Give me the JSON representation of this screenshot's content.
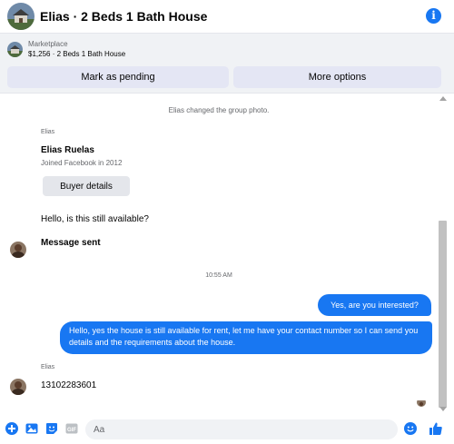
{
  "header": {
    "title": "Elias · 2 Beds 1 Bath House",
    "avatar_icon": "house-photo-icon",
    "info_icon": "info-icon"
  },
  "marketplace": {
    "label": "Marketplace",
    "listing": "$1,256 · 2 Beds 1 Bath House",
    "pending_button": "Mark as pending",
    "more_button": "More options"
  },
  "chat": {
    "system_notice": "Elias changed the group photo.",
    "profile": {
      "sender": "Elias",
      "name": "Elias Ruelas",
      "joined": "Joined Facebook in 2012",
      "buyer_button": "Buyer details"
    },
    "incoming_1": "Hello, is this still available?",
    "incoming_2": "Message sent",
    "timestamp": "10:55 AM",
    "outgoing_1": "Yes, are you interested?",
    "outgoing_2": "Hello, yes the house is still available for rent, let me have your contact number so I can send you details and the requirements about the house.",
    "sender_2": "Elias",
    "incoming_3": "13102283601"
  },
  "composer": {
    "placeholder": "Aa",
    "icons": [
      "plus-icon",
      "image-icon",
      "sticker-icon",
      "gif-icon",
      "emoji-icon",
      "like-icon"
    ]
  },
  "colors": {
    "accent": "#1877f2",
    "button_bg": "#e4e6f4",
    "panel_bg": "#f0f2f5"
  }
}
